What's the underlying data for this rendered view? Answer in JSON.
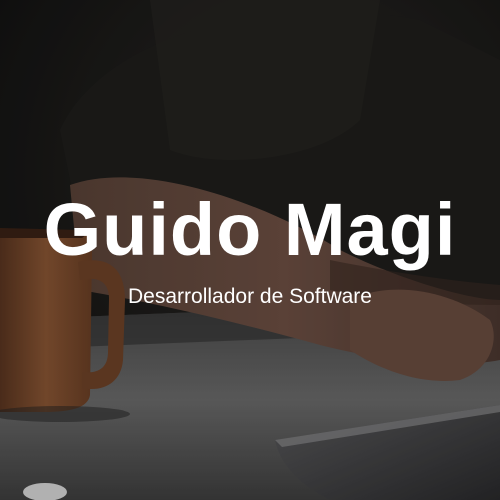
{
  "hero": {
    "title": "Guido Magi",
    "subtitle": "Desarrollador de Software",
    "background_image": "person-at-desk-with-coffee-mug-and-laptop",
    "colors": {
      "text": "#ffffff",
      "background": "#1a1917"
    }
  }
}
